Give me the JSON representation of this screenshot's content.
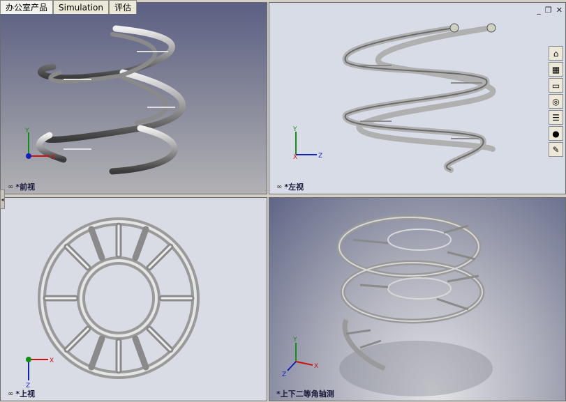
{
  "tabs": [
    "办公室产品",
    "Simulation",
    "评估"
  ],
  "viewports": {
    "front": {
      "label": "*前视"
    },
    "left": {
      "label": "*左视"
    },
    "top": {
      "label": "*上视"
    },
    "iso": {
      "label": "*上下二等角轴测"
    }
  },
  "axes": {
    "x": "X",
    "y": "Y",
    "z": "Z"
  },
  "window_controls": {
    "minimize": "_",
    "restore": "❐",
    "close": "✕"
  },
  "task_pane": [
    {
      "name": "home-icon",
      "glyph": "⌂"
    },
    {
      "name": "design-library-icon",
      "glyph": "▦"
    },
    {
      "name": "file-explorer-icon",
      "glyph": "▭"
    },
    {
      "name": "search-icon",
      "glyph": "◎"
    },
    {
      "name": "view-palette-icon",
      "glyph": "☰"
    },
    {
      "name": "appearances-icon",
      "glyph": "●"
    },
    {
      "name": "custom-properties-icon",
      "glyph": "✎"
    }
  ],
  "colors": {
    "axis_x": "#d01010",
    "axis_y": "#109010",
    "axis_z": "#1020c0",
    "metal": "#b8b8b8"
  }
}
